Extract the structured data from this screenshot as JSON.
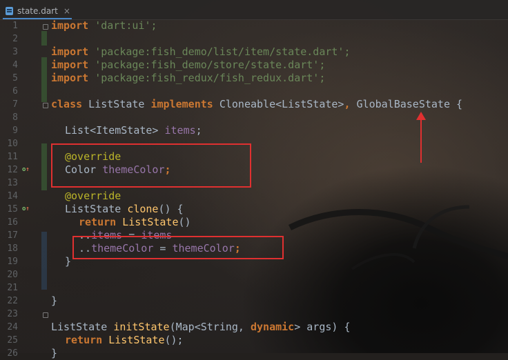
{
  "tab": {
    "filename": "state.dart",
    "icon": "dart-file-icon",
    "close": "×"
  },
  "colors": {
    "keyword": "#cc7832",
    "string": "#6a8759",
    "annotation": "#bbb529",
    "field": "#9876aa",
    "function": "#ffc66d",
    "text": "#a9b7c6",
    "highlight_box": "#e03030"
  },
  "gutter": {
    "line_numbers": [
      "1",
      "2",
      "3",
      "4",
      "5",
      "6",
      "7",
      "8",
      "9",
      "10",
      "11",
      "12",
      "13",
      "14",
      "15",
      "16",
      "17",
      "18",
      "19",
      "20",
      "21",
      "22",
      "23",
      "24",
      "25",
      "26"
    ],
    "override_markers": [
      {
        "line": "12",
        "icon": "override-up-arrow-icon",
        "glyph": "o",
        "arrow": "↑"
      },
      {
        "line": "15",
        "icon": "override-up-arrow-icon",
        "glyph": "o",
        "arrow": "↑"
      }
    ]
  },
  "code": {
    "l1": {
      "kw": "import",
      "str": "'dart:ui';"
    },
    "l3": {
      "kw": "import",
      "str": "'package:fish_demo/list/item/state.dart';"
    },
    "l4": {
      "kw": "import",
      "str": "'package:fish_demo/store/state.dart';"
    },
    "l5": {
      "kw": "import",
      "str": "'package:fish_redux/fish_redux.dart';"
    },
    "l7": {
      "kw1": "class",
      "t1": " ListState ",
      "kw2": "implements",
      "t2": " Cloneable<ListState>",
      "comma": ",",
      "t3": " GlobalBaseState {"
    },
    "l9": {
      "t1": "List<ItemState> ",
      "fld": "items",
      "t2": ";"
    },
    "l11": {
      "ann": "@override"
    },
    "l12": {
      "t1": "Color ",
      "fld": "themeColor",
      "t2": ";"
    },
    "l14": {
      "ann": "@override"
    },
    "l15": {
      "t1": "ListState ",
      "fn": "clone",
      "t2": "() {"
    },
    "l16": {
      "kw": "return",
      "fn": " ListState",
      "t2": "()"
    },
    "l17": {
      "t1": "..",
      "fld1": "items",
      "t2": " = ",
      "fld2": "items"
    },
    "l18": {
      "t1": "..",
      "fld1": "themeColor",
      "t2": " = ",
      "fld2": "themeColor",
      "t3": ";"
    },
    "l19": {
      "t1": "}"
    },
    "l22": {
      "t1": "}"
    },
    "l24": {
      "t1": "ListState ",
      "fn": "initState",
      "t2": "(Map<String, ",
      "kw": "dynamic",
      "t3": "> args) {"
    },
    "l25": {
      "kw": "return",
      "fn": " ListState",
      "t2": "();"
    },
    "l26": {
      "t1": "}"
    }
  }
}
